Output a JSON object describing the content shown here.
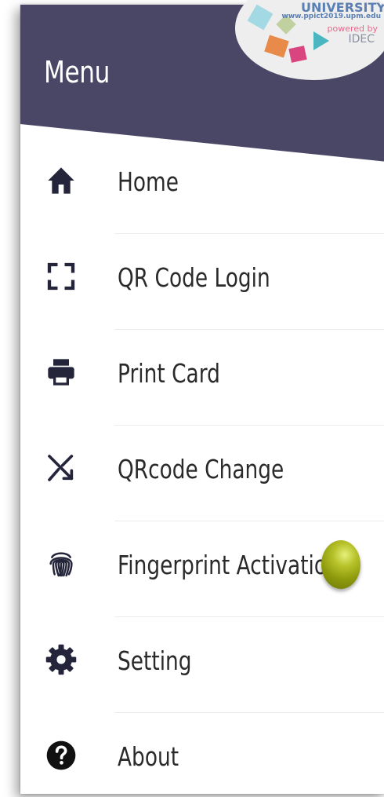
{
  "header": {
    "title": "Menu"
  },
  "menu": {
    "items": [
      {
        "label": "Home",
        "icon": "home-icon"
      },
      {
        "label": "QR Code Login",
        "icon": "qr-scan-icon"
      },
      {
        "label": "Print Card",
        "icon": "printer-icon"
      },
      {
        "label": "QRcode Change",
        "icon": "shuffle-icon"
      },
      {
        "label": "Fingerprint Activation",
        "icon": "fingerprint-icon"
      },
      {
        "label": "Setting",
        "icon": "gear-icon"
      },
      {
        "label": "About",
        "icon": "help-circle-icon"
      }
    ]
  },
  "fingerprint_toggle": {
    "state": "on",
    "color": "#9aa612"
  },
  "watermark": {
    "title": "UNIVERSITY",
    "url": "www.ppict2019.upm.edu",
    "powered": "powered by",
    "brand": "IDEC"
  },
  "colors": {
    "header_bg": "#4a4766",
    "header_text": "#ffffff",
    "icon": "#24253a",
    "label": "#2a2a2a"
  }
}
